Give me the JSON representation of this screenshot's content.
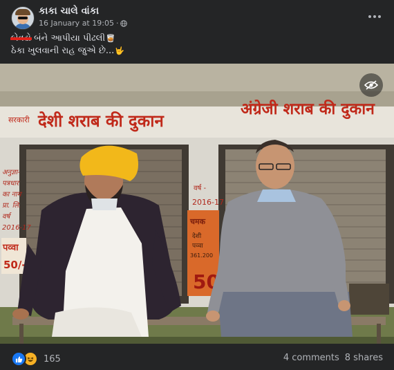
{
  "post": {
    "page_name": "કાકા ચાલે વાંકા",
    "timestamp": "16 January at 19:05",
    "separator": "·",
    "caption_struck": "બેવડો",
    "caption_line1_rest": " બંને આપીયા પીઢલી",
    "caption_line2": "ઠેકા ખુલવાની રાહ જુએ છે...",
    "emoji_1": "🥃",
    "emoji_2": "🤟"
  },
  "photo": {
    "sign_left": "सरकारी देशी शराब की दुकान",
    "sign_left_small": "सरकारी",
    "sign_left_big": "देशी शराब की दुकान",
    "sign_right": "अंग्रेजी शराब की दुकान",
    "wall_text_left": [
      "अनुज्ञा-",
      "पत्रधार",
      "का नाम",
      "प्रा. लि.",
      "वर्ष",
      "2016-17"
    ],
    "wall_price_left": [
      "पव्वा",
      "50/-"
    ],
    "wall_text_mid": [
      "वर्ष -",
      "2016-17"
    ],
    "poster_text": [
      "चमक",
      "देशी",
      "पव्वा",
      "361.200",
      "50"
    ]
  },
  "footer": {
    "reaction_count": "165",
    "comments": "4 comments",
    "shares": "8 shares"
  },
  "icons": [
    "avatar",
    "globe-icon",
    "more-icon",
    "eye-icon",
    "like-icon",
    "haha-icon"
  ],
  "colors": {
    "background": "#242526",
    "text": "#e4e6eb",
    "muted": "#b0b3b8",
    "like": "#1877f2",
    "strike": "#e0221a",
    "haha": "#f7b125"
  }
}
